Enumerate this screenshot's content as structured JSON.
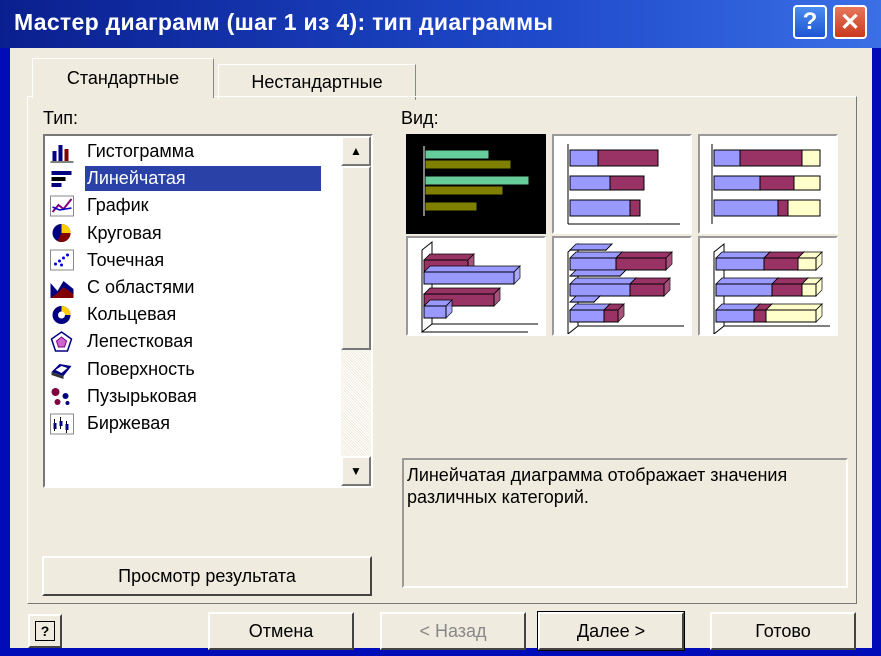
{
  "window": {
    "title": "Мастер диаграмм (шаг 1 из 4): тип диаграммы",
    "help_symbol": "?",
    "close_symbol": "✕"
  },
  "tabs": [
    {
      "label": "Стандартные",
      "active": true
    },
    {
      "label": "Нестандартные",
      "active": false
    }
  ],
  "type_label": "Тип:",
  "view_label": "Вид:",
  "chart_types": [
    {
      "label": "Гистограмма",
      "icon": "column-chart-icon"
    },
    {
      "label": "Линейчатая",
      "icon": "bar-chart-icon",
      "selected": true
    },
    {
      "label": "График",
      "icon": "line-chart-icon"
    },
    {
      "label": "Круговая",
      "icon": "pie-chart-icon"
    },
    {
      "label": "Точечная",
      "icon": "scatter-chart-icon"
    },
    {
      "label": "С областями",
      "icon": "area-chart-icon"
    },
    {
      "label": "Кольцевая",
      "icon": "doughnut-chart-icon"
    },
    {
      "label": "Лепестковая",
      "icon": "radar-chart-icon"
    },
    {
      "label": "Поверхность",
      "icon": "surface-chart-icon"
    },
    {
      "label": "Пузырьковая",
      "icon": "bubble-chart-icon"
    },
    {
      "label": "Биржевая",
      "icon": "stock-chart-icon"
    }
  ],
  "subtypes": [
    {
      "name": "clustered-bar",
      "selected": true
    },
    {
      "name": "stacked-bar"
    },
    {
      "name": "percent-stacked-bar"
    },
    {
      "name": "3d-clustered-bar"
    },
    {
      "name": "3d-stacked-bar"
    },
    {
      "name": "3d-percent-stacked-bar"
    }
  ],
  "description": "Линейчатая диаграмма отображает значения различных категорий.",
  "buttons": {
    "preview": "Просмотр результата",
    "cancel": "Отмена",
    "back": "< Назад",
    "next": "Далее >",
    "finish": "Готово",
    "assistant": "?"
  },
  "colors": {
    "title_bar": "#1e49c9",
    "dialog_bg": "#efebde",
    "selection": "#2a42a8",
    "bar_purple": "#993366",
    "bar_lavender": "#9999ff",
    "bar_cream": "#ffffcc",
    "bar_teal": "#66cc99",
    "bar_olive": "#808000"
  }
}
